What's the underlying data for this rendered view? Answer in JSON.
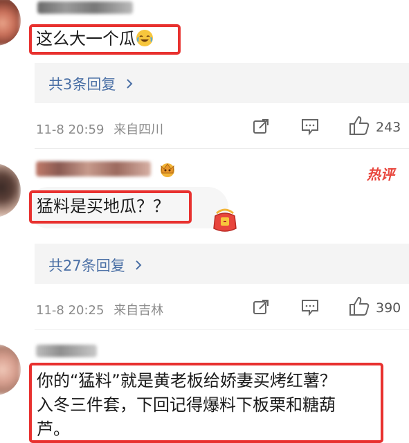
{
  "comments": [
    {
      "text": "这么大一个瓜",
      "emoji": "laughing-tears-emoji",
      "replies_label": "共3条回复",
      "time": "11-8 20:59",
      "location": "来自四川",
      "likes": "243"
    },
    {
      "text": "猛料是买地瓜？？",
      "badge": "热评",
      "replies_label": "共27条回复",
      "time": "11-8 20:25",
      "location": "来自吉林",
      "likes": "390"
    },
    {
      "text_line1": "你的“猛料”就是黄老板给娇妻买烤红薯？",
      "text_line2": "入冬三件套，下回记得爆料下板栗和糖葫",
      "text_line3": "芦。"
    }
  ],
  "colors": {
    "highlight": "#e8312f",
    "link": "#4a6fa5",
    "meta": "#8a8a8a",
    "reply_bg": "#f4f4f4"
  }
}
